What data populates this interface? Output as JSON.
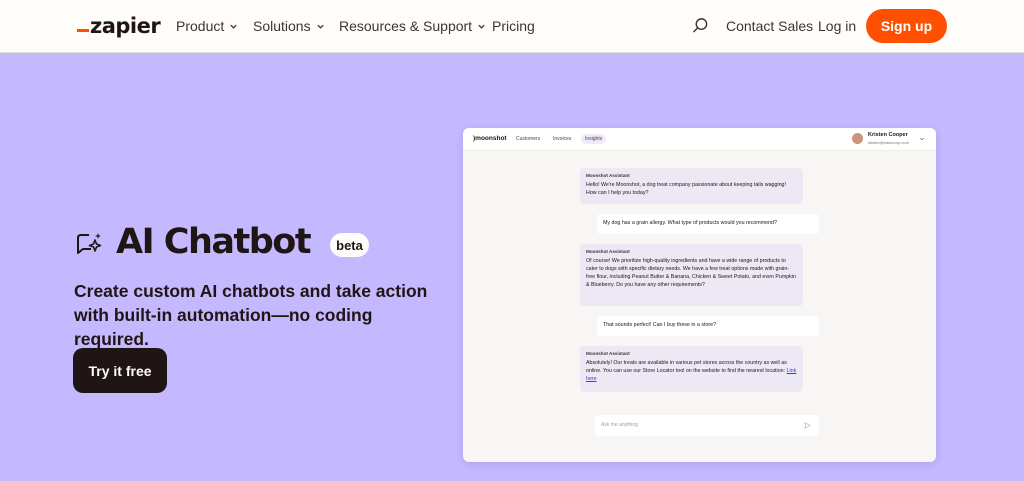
{
  "nav": {
    "logo": "zapier",
    "items": [
      {
        "label": "Product"
      },
      {
        "label": "Solutions"
      },
      {
        "label": "Resources & Support"
      },
      {
        "label": "Pricing"
      }
    ],
    "contact_sales": "Contact Sales",
    "log_in": "Log in",
    "sign_up": "Sign up"
  },
  "hero": {
    "title": "AI Chatbot",
    "badge": "beta",
    "subtitle": "Create custom AI chatbots and take action with built-in automation—no coding required.",
    "cta": "Try it free"
  },
  "app": {
    "logo": "moonshot",
    "tabs": [
      "Customers",
      "Invoices",
      "Insights"
    ],
    "active_tab": "Insights",
    "user": {
      "name": "Kristen Cooper",
      "email": "kristen@eazecorp.com"
    },
    "messages": [
      {
        "sender": "Moonshot Assistant",
        "text": "Hello! We're Moonshot, a dog treat company passionate about keeping tails wagging! How can I help you today?"
      },
      {
        "text": "My dog has a grain allergy. What type of products would you recommend?"
      },
      {
        "sender": "Moonshot Assistant",
        "text": "Of course! We prioritize high-quality ingredients and have a wide range of products to cater to dogs with specific dietary needs. We have a few treat options made with grain-free flour, including Peanut Butter & Banana, Chicken & Sweet Potato, and even Pumpkin & Blueberry. Do you have any other requirements?"
      },
      {
        "text": "That sounds perfect! Can I buy these in a store?"
      },
      {
        "sender": "Moonshot Assistant",
        "text": "Absolutely! Our treats are available in various pet stores across the country as well as online. You can use our Store Locator tool on the website to find the nearest location:",
        "link": "Link here"
      }
    ],
    "input_placeholder": "Ask me anything"
  },
  "colors": {
    "background": "#c4b8ff",
    "accent": "#ff4f00",
    "dark": "#201515"
  }
}
